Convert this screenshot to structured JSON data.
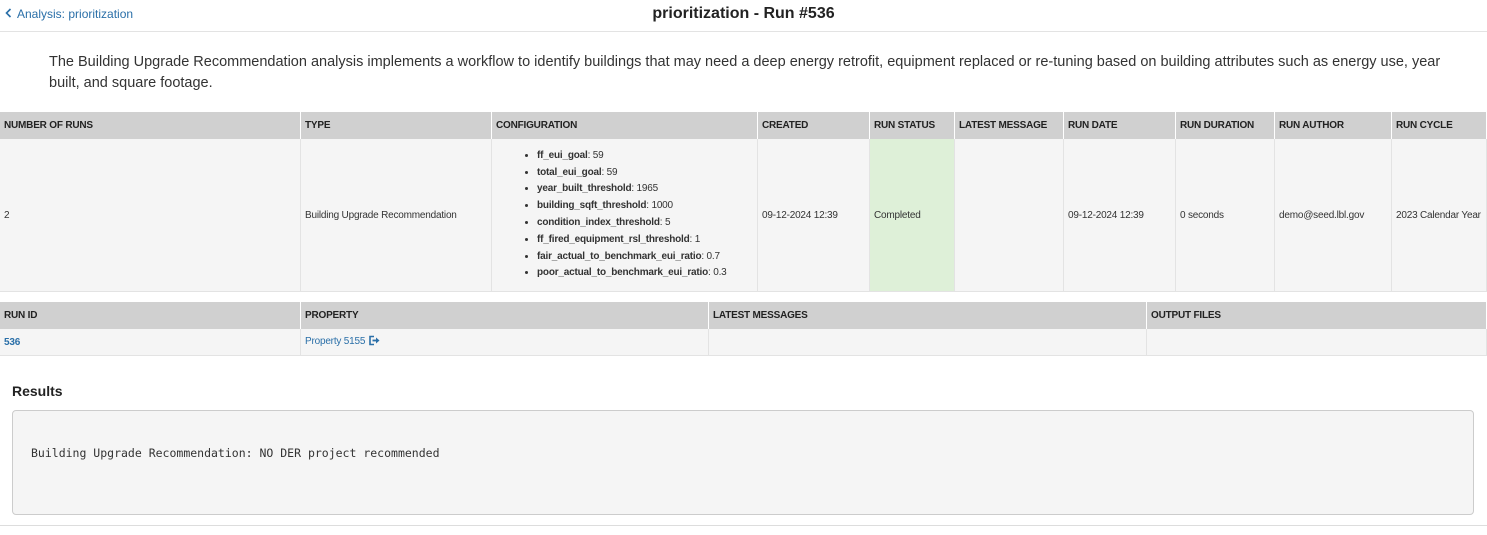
{
  "header": {
    "back_label": "Analysis: prioritization",
    "title": "prioritization - Run #536"
  },
  "description": "The Building Upgrade Recommendation analysis implements a workflow to identify buildings that may need a deep energy retrofit, equipment replaced or re-tuning based on building attributes such as energy use, year built, and square footage.",
  "runs_table": {
    "headers": [
      "NUMBER OF RUNS",
      "TYPE",
      "CONFIGURATION",
      "CREATED",
      "RUN STATUS",
      "LATEST MESSAGE",
      "RUN DATE",
      "RUN DURATION",
      "RUN AUTHOR",
      "RUN CYCLE"
    ],
    "row": {
      "number_of_runs": "2",
      "type": "Building Upgrade Recommendation",
      "configuration": [
        {
          "key": "ff_eui_goal",
          "value": ": 59"
        },
        {
          "key": "total_eui_goal",
          "value": ": 59"
        },
        {
          "key": "year_built_threshold",
          "value": ": 1965"
        },
        {
          "key": "building_sqft_threshold",
          "value": ": 1000"
        },
        {
          "key": "condition_index_threshold",
          "value": ": 5"
        },
        {
          "key": "ff_fired_equipment_rsl_threshold",
          "value": ": 1"
        },
        {
          "key": "fair_actual_to_benchmark_eui_ratio",
          "value": ": 0.7"
        },
        {
          "key": "poor_actual_to_benchmark_eui_ratio",
          "value": ": 0.3"
        }
      ],
      "created": "09-12-2024 12:39",
      "run_status": "Completed",
      "latest_message": "",
      "run_date": "09-12-2024 12:39",
      "run_duration": "0 seconds",
      "run_author": "demo@seed.lbl.gov",
      "run_cycle": "2023 Calendar Year"
    }
  },
  "details_table": {
    "headers": [
      "RUN ID",
      "PROPERTY",
      "LATEST MESSAGES",
      "OUTPUT FILES"
    ],
    "row": {
      "run_id": "536",
      "property": "Property 5155",
      "latest_messages": "",
      "output_files": ""
    }
  },
  "results": {
    "title": "Results",
    "text": "Building Upgrade Recommendation: NO DER project recommended"
  },
  "colors": {
    "link": "#2a6fa8",
    "header_bg": "#d0d0d0",
    "status_completed_bg": "#def0d8"
  },
  "icons": {
    "back": "chevron-left-icon",
    "external": "external-link-icon"
  }
}
